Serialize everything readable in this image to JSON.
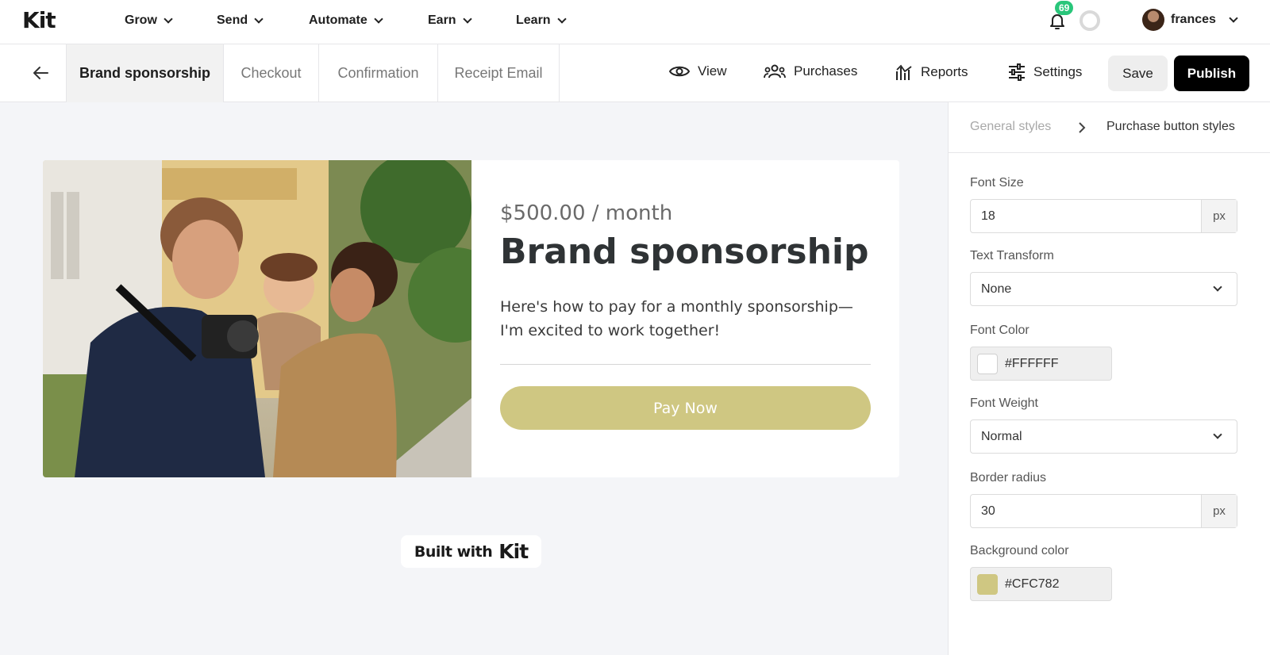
{
  "app": {
    "logo": "Kit"
  },
  "nav": {
    "items": [
      {
        "label": "Grow"
      },
      {
        "label": "Send"
      },
      {
        "label": "Automate"
      },
      {
        "label": "Earn"
      },
      {
        "label": "Learn"
      }
    ],
    "notifications": "69",
    "user": "frances"
  },
  "tabs": [
    {
      "label": "Brand sponsorship",
      "active": true
    },
    {
      "label": "Checkout"
    },
    {
      "label": "Confirmation"
    },
    {
      "label": "Receipt Email"
    }
  ],
  "toolbar": {
    "view": "View",
    "purchases": "Purchases",
    "reports": "Reports",
    "settings": "Settings",
    "save": "Save",
    "publish": "Publish"
  },
  "product": {
    "price": "$500.00 / month",
    "title": "Brand sponsorship",
    "description": "Here's how to pay for a monthly sponsorship—I'm excited to work together!",
    "button": "Pay Now",
    "button_color": "#CFC782"
  },
  "footer": {
    "built_with": "Built with",
    "brand": "Kit"
  },
  "panel": {
    "breadcrumb_parent": "General styles",
    "breadcrumb_current": "Purchase button styles",
    "font_size_label": "Font Size",
    "font_size": "18",
    "font_size_unit": "px",
    "text_transform_label": "Text Transform",
    "text_transform": "None",
    "font_color_label": "Font Color",
    "font_color": "#FFFFFF",
    "font_weight_label": "Font Weight",
    "font_weight": "Normal",
    "border_radius_label": "Border radius",
    "border_radius": "30",
    "border_radius_unit": "px",
    "bg_color_label": "Background color",
    "bg_color": "#CFC782"
  }
}
